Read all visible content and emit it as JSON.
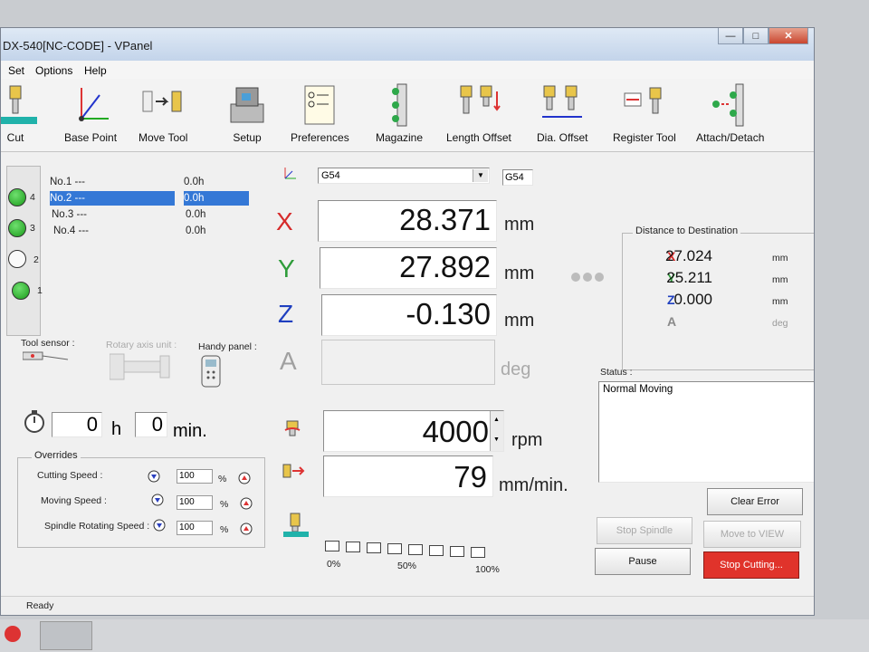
{
  "window": {
    "title": "DX-540[NC-CODE] - VPanel",
    "status_bar": "Ready"
  },
  "menu": [
    "Set",
    "Options",
    "Help"
  ],
  "toolbar": [
    {
      "label": "Cut",
      "icon": "cut-icon"
    },
    {
      "label": "Base Point",
      "icon": "base-point-icon"
    },
    {
      "label": "Move Tool",
      "icon": "move-tool-icon"
    },
    {
      "label": "Setup",
      "icon": "setup-icon"
    },
    {
      "label": "Preferences",
      "icon": "preferences-icon"
    },
    {
      "label": "Magazine",
      "icon": "magazine-icon"
    },
    {
      "label": "Length Offset",
      "icon": "length-offset-icon"
    },
    {
      "label": "Dia. Offset",
      "icon": "dia-offset-icon"
    },
    {
      "label": "Register Tool",
      "icon": "register-tool-icon"
    },
    {
      "label": "Attach/Detach",
      "icon": "attach-detach-icon"
    }
  ],
  "tools": [
    {
      "name": "No.1",
      "desc": "---",
      "time": "0.0h",
      "selected": false
    },
    {
      "name": "No.2",
      "desc": "---",
      "time": "0.0h",
      "selected": true
    },
    {
      "name": "No.3",
      "desc": "---",
      "time": "0.0h",
      "selected": false
    },
    {
      "name": "No.4",
      "desc": "---",
      "time": "0.0h",
      "selected": false
    }
  ],
  "magazine_slots": [
    {
      "num": "4",
      "state": "on"
    },
    {
      "num": "3",
      "state": "on"
    },
    {
      "num": "2",
      "state": "off"
    },
    {
      "num": "1",
      "state": "on"
    }
  ],
  "devices": {
    "tool_sensor": "Tool sensor :",
    "rotary_axis": "Rotary axis unit :",
    "handy_panel": "Handy panel :"
  },
  "timer": {
    "hours": "0",
    "h_label": "h",
    "minutes": "0",
    "min_label": "min."
  },
  "overrides": {
    "title": "Overrides",
    "items": [
      {
        "label": "Cutting Speed :",
        "value": "100",
        "unit": "%"
      },
      {
        "label": "Moving Speed :",
        "value": "100",
        "unit": "%"
      },
      {
        "label": "Spindle Rotating Speed :",
        "value": "100",
        "unit": "%"
      }
    ]
  },
  "coord": {
    "system": "G54",
    "system_box": "G54"
  },
  "axes": [
    {
      "name": "X",
      "value": "28.371",
      "unit": "mm",
      "color": "#d62b2b"
    },
    {
      "name": "Y",
      "value": "27.892",
      "unit": "mm",
      "color": "#2e9c3a"
    },
    {
      "name": "Z",
      "value": "-0.130",
      "unit": "mm",
      "color": "#1f3fbf"
    },
    {
      "name": "A",
      "value": "",
      "unit": "deg",
      "color": "#a0a0a0"
    }
  ],
  "spindle": {
    "value": "4000",
    "unit": "rpm"
  },
  "feed": {
    "value": "79",
    "unit": "mm/min."
  },
  "progress": {
    "labels": [
      "0%",
      "50%",
      "100%"
    ],
    "segments": 8,
    "filled": 0
  },
  "destination": {
    "title": "Distance to Destination",
    "rows": [
      {
        "axis": "X",
        "value": "27.024",
        "unit": "mm",
        "color": "#d62b2b"
      },
      {
        "axis": "Y",
        "value": "25.211",
        "unit": "mm",
        "color": "#2e9c3a"
      },
      {
        "axis": "Z",
        "value": "0.000",
        "unit": "mm",
        "color": "#1f3fbf"
      },
      {
        "axis": "A",
        "value": "",
        "unit": "deg",
        "color": "#8a8a8a"
      }
    ]
  },
  "status": {
    "label": "Status :",
    "text": "Normal Moving"
  },
  "buttons": {
    "clear_error": "Clear Error",
    "stop_spindle": "Stop Spindle",
    "move_to_view": "Move to VIEW",
    "pause": "Pause",
    "stop_cutting": "Stop Cutting..."
  }
}
